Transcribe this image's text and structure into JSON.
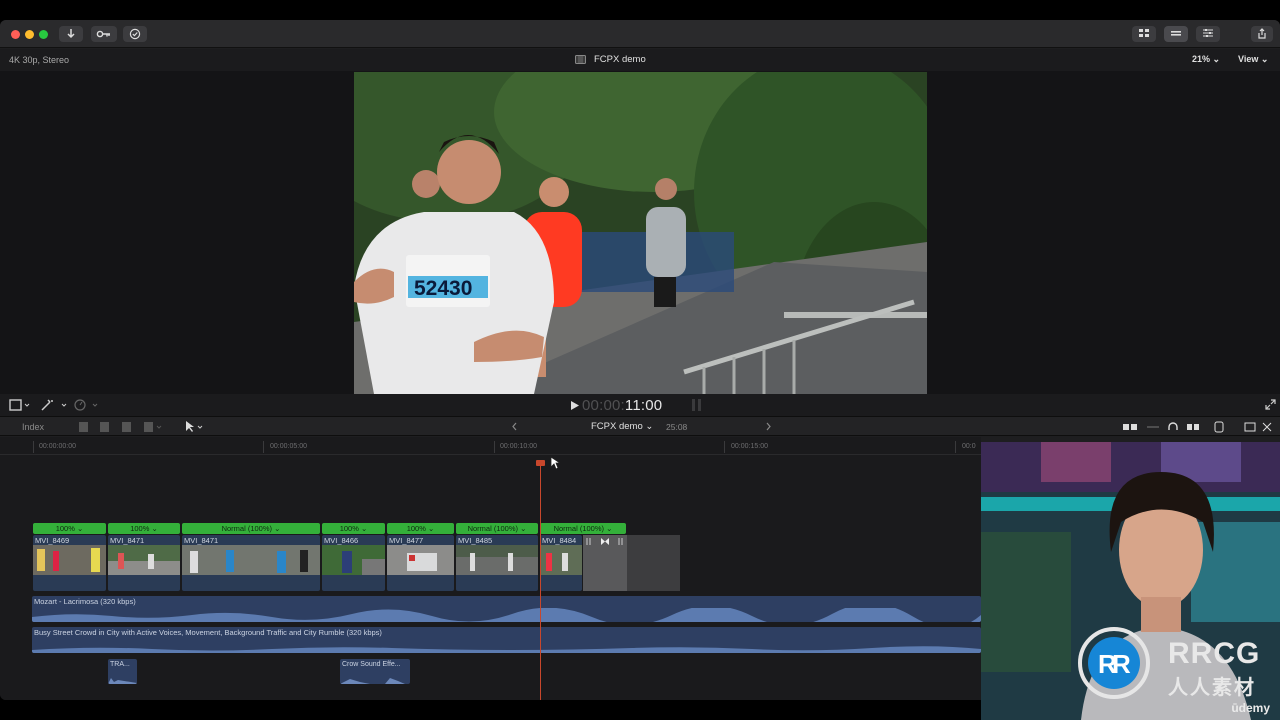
{
  "window": {
    "traffic_lights": [
      "#ff5f57",
      "#febc2e",
      "#28c840"
    ]
  },
  "toolbar": {
    "import_icon": "download-arrow",
    "keywords_icon": "key",
    "background_tasks_icon": "check-circle"
  },
  "viewer": {
    "format": "4K 30p, Stereo",
    "project_title": "FCPX demo",
    "zoom": "21% ⌄",
    "view_menu": "View ⌄",
    "timecode_dim": "00:00:",
    "timecode_active": "11:00",
    "bib_number": "52430"
  },
  "timeline": {
    "index_label": "Index",
    "project_name": "FCPX demo ⌄",
    "duration": "25:08",
    "ruler_labels": [
      "00:00:00:00",
      "00:00:05:00",
      "00:00:10:00",
      "00:00:15:00",
      "00:0"
    ],
    "clips": [
      {
        "speed": "100% ⌄",
        "name": "MVI_8469"
      },
      {
        "speed": "100% ⌄",
        "name": "MVI_8471"
      },
      {
        "speed": "Normal (100%) ⌄",
        "name": "MVI_8471"
      },
      {
        "speed": "100% ⌄",
        "name": "MVI_8466"
      },
      {
        "speed": "100% ⌄",
        "name": "MVI_8477"
      },
      {
        "speed": "Normal (100%) ⌄",
        "name": "MVI_8485"
      },
      {
        "speed": "Normal (100%) ⌄",
        "name": "MVI_8484"
      }
    ],
    "audio_tracks": [
      "Mozart - Lacrimosa (320 kbps)",
      "Busy Street Crowd in City with Active Voices, Movement, Background Traffic and City Rumble (320 kbps)"
    ],
    "sound_effects": [
      "TRA...",
      "Crow Sound Effe..."
    ]
  },
  "overlay": {
    "brand": "RRCG",
    "brand_sub": "人人素材",
    "watermark": "ūdemy"
  }
}
